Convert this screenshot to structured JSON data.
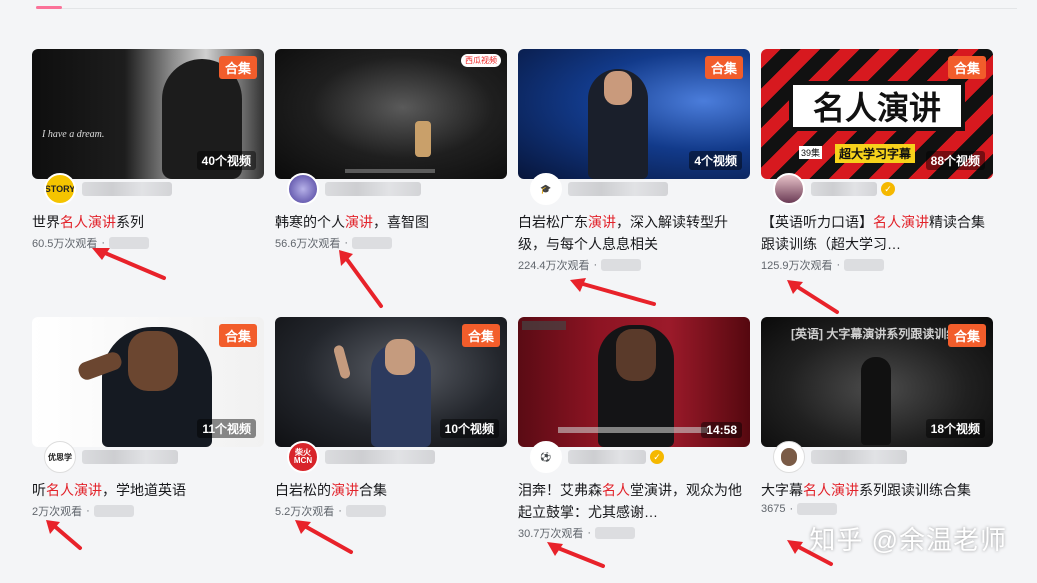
{
  "cards": [
    {
      "title_pre": "世界",
      "title_hl": "名人演讲",
      "title_post": "系列",
      "views": "60.5万次观看",
      "badge": "合集",
      "count": "40个视频",
      "thumb_text": "I have a dream.",
      "avatar_text": "STORY"
    },
    {
      "title_pre": "韩寒的个人",
      "title_hl": "演讲",
      "title_post": "，喜智图",
      "views": "56.6万次观看",
      "badge": "",
      "count": "",
      "thumb_text": "西瓜视频",
      "avatar_text": ""
    },
    {
      "title_pre": "白岩松广东",
      "title_hl": "演讲",
      "title_post": "，深入解读转型升级，与每个人息息相关",
      "views": "224.4万次观看",
      "badge": "合集",
      "count": "4个视频",
      "thumb_text": "",
      "avatar_text": ""
    },
    {
      "title_pre": "【英语听力口语】",
      "title_hl": "名人演讲",
      "title_post": "精读合集跟读训练（超大学习…",
      "views": "125.9万次观看",
      "badge": "合集",
      "count": "88个视频",
      "thumb_text": "名人演讲",
      "thumb_sub": "超大学习字幕",
      "thumb_tag": "39集",
      "avatar_text": ""
    },
    {
      "title_pre": "听",
      "title_hl": "名人演讲",
      "title_post": "，学地道英语",
      "views": "2万次观看",
      "badge": "合集",
      "count": "11个视频",
      "thumb_text": "",
      "avatar_text": "优思学"
    },
    {
      "title_pre": "白岩松的",
      "title_hl": "演讲",
      "title_post": "合集",
      "views": "5.2万次观看",
      "badge": "合集",
      "count": "10个视频",
      "thumb_text": "",
      "avatar_text": "柴火 MCN"
    },
    {
      "title_pre": "泪奔！艾弗森",
      "title_hl": "名人",
      "title_post": "堂演讲，观众为他起立鼓掌：尤其感谢…",
      "views": "30.7万次观看",
      "badge": "",
      "count": "14:58",
      "thumb_text": "",
      "avatar_text": ""
    },
    {
      "title_pre": "大字幕",
      "title_hl": "名人演讲",
      "title_post": "系列跟读训练合集",
      "views": "3675",
      "badge": "合集",
      "count": "18个视频",
      "thumb_text": "[英语] 大字幕演讲系列跟读训练",
      "avatar_text": ""
    }
  ],
  "watermark": "知乎 @余温老师",
  "colors": {
    "accent": "#fb7299",
    "highlight": "#e2222a",
    "badge": "#f25d2b",
    "arrow": "#e8222a"
  }
}
